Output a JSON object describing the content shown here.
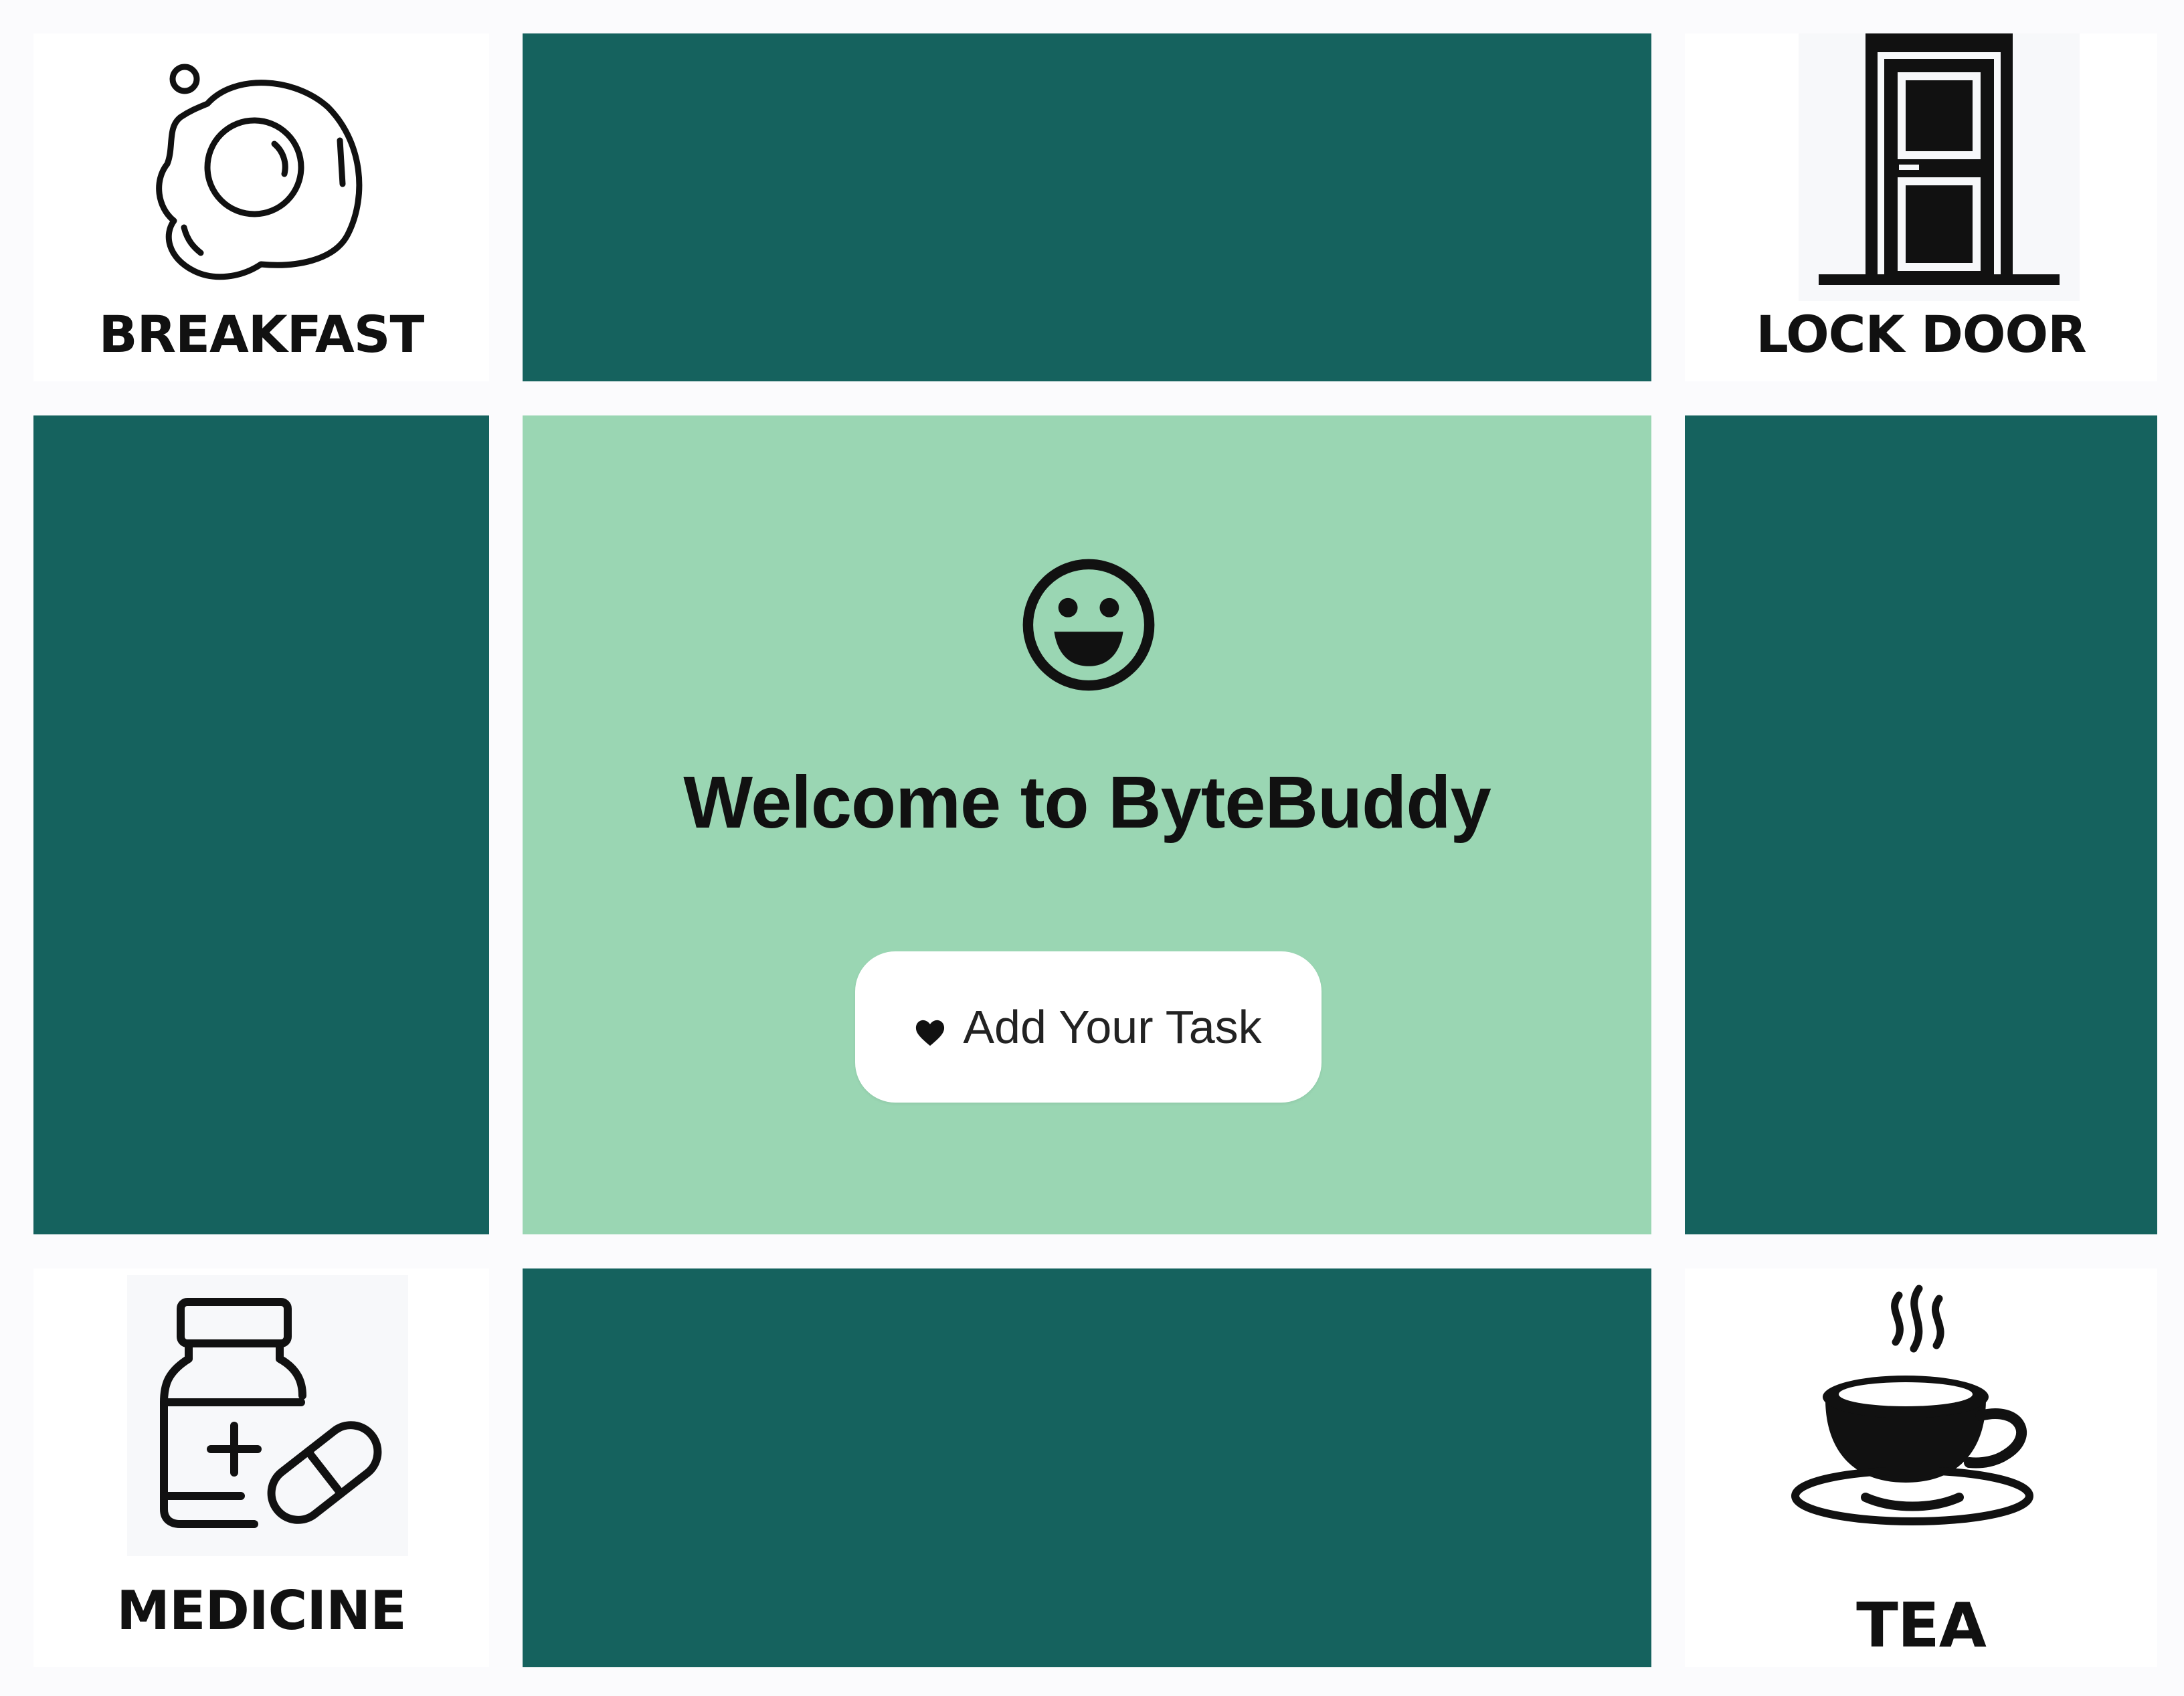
{
  "app": {
    "welcome_title": "Welcome to ByteBuddy",
    "add_task_button": "Add Your Task"
  },
  "tasks": {
    "breakfast": {
      "label": "BREAKFAST",
      "icon": "fried-egg-icon"
    },
    "lock_door": {
      "label": "LOCK DOOR",
      "icon": "door-icon"
    },
    "medicine": {
      "label": "MEDICINE",
      "icon": "medicine-bottle-icon"
    },
    "tea": {
      "label": "TEA",
      "icon": "teacup-icon"
    }
  },
  "colors": {
    "dark_panel": "#15625e",
    "center_panel": "#9ad6b3",
    "tile_background": "#ffffff",
    "text": "#111111"
  }
}
